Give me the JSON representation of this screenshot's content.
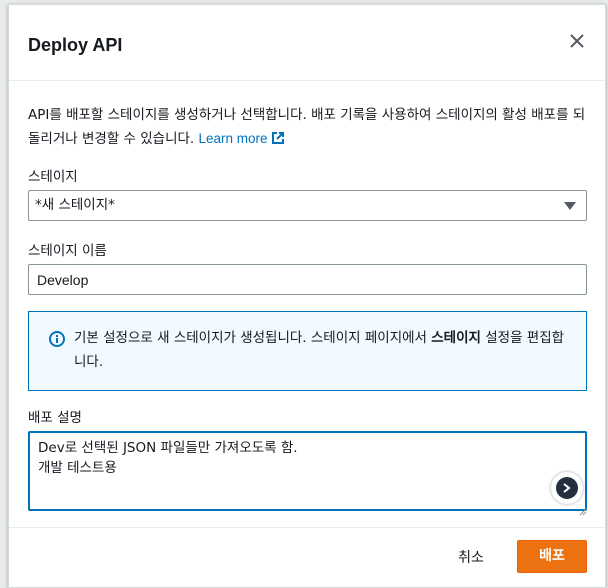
{
  "dialog": {
    "title": "Deploy API",
    "description": "API를 배포할 스테이지를 생성하거나 선택합니다. 배포 기록을 사용하여 스테이지의 활성 배포를 되돌리거나 변경할 수 있습니다.",
    "learn_more": "Learn more"
  },
  "stage": {
    "label": "스테이지",
    "selected": "*새 스테이지*"
  },
  "stage_name": {
    "label": "스테이지 이름",
    "value": "Develop"
  },
  "info": {
    "text_before": "기본 설정으로 새 스테이지가 생성됩니다. 스테이지 페이지에서 ",
    "text_bold": "스테이지",
    "text_after": " 설정을 편집합니다."
  },
  "deploy_description": {
    "label": "배포 설명",
    "value": "Dev로 선택된 JSON 파일들만 가져오도록 함.\n개발 테스트용"
  },
  "footer": {
    "cancel_label": "취소",
    "deploy_label": "배포"
  },
  "colors": {
    "accent_link": "#0073bb",
    "primary_button": "#ec7211",
    "info_background": "#f1faff"
  },
  "icons": [
    "close-icon",
    "external-link-icon",
    "info-icon",
    "resize-grip-icon",
    "assistant-icon"
  ]
}
